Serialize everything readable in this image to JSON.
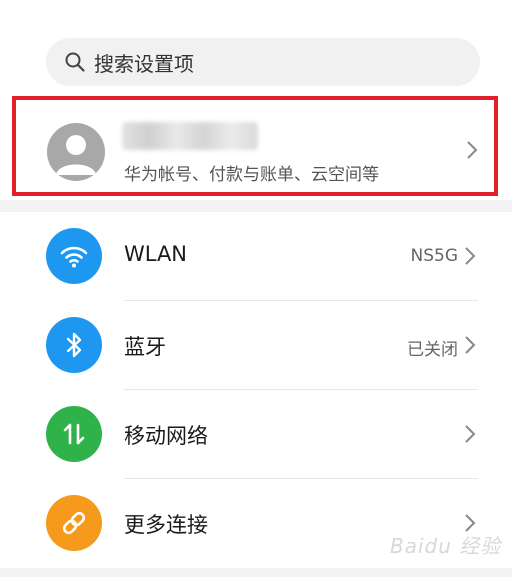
{
  "search": {
    "placeholder": "搜索设置项",
    "icon": "search-icon"
  },
  "account": {
    "subtitle": "华为帐号、付款与账单、云空间等",
    "highlight_color": "#e0202a"
  },
  "settings": [
    {
      "label": "WLAN",
      "value": "NS5G",
      "icon": "wifi-icon",
      "color": "#1e97f0"
    },
    {
      "label": "蓝牙",
      "value": "已关闭",
      "icon": "bluetooth-icon",
      "color": "#1e97f0"
    },
    {
      "label": "移动网络",
      "value": "",
      "icon": "mobile-data-icon",
      "color": "#2fb24a"
    },
    {
      "label": "更多连接",
      "value": "",
      "icon": "link-icon",
      "color": "#f59a1c"
    }
  ],
  "watermark": "Baidu 经验"
}
